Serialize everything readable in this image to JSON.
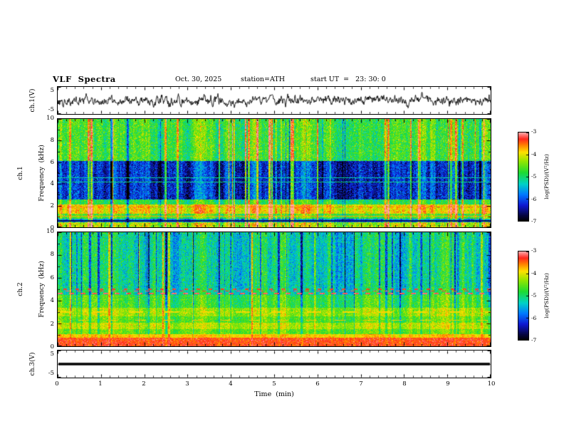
{
  "header": {
    "title": "VLF  Spectra",
    "date": "Oct. 30, 2025",
    "station": "station=ATH",
    "start_ut": "start UT  =   23: 30: 0"
  },
  "time_axis": {
    "label": "Time  (min)",
    "min": 0,
    "max": 10,
    "ticks": [
      0,
      1,
      2,
      3,
      4,
      5,
      6,
      7,
      8,
      9,
      10
    ],
    "minor_per_major": 5
  },
  "colorbar": {
    "label": "log(PSD)/(V²/Hz)",
    "min": -7,
    "max": -3,
    "ticks": [
      -3,
      -4,
      -5,
      -6,
      -7
    ]
  },
  "colormap_stops": [
    [
      0.0,
      0,
      0,
      0
    ],
    [
      0.06,
      5,
      5,
      60
    ],
    [
      0.18,
      15,
      25,
      210
    ],
    [
      0.3,
      0,
      120,
      255
    ],
    [
      0.42,
      0,
      210,
      200
    ],
    [
      0.55,
      30,
      220,
      50
    ],
    [
      0.68,
      150,
      230,
      0
    ],
    [
      0.78,
      255,
      225,
      0
    ],
    [
      0.86,
      255,
      130,
      0
    ],
    [
      0.93,
      255,
      40,
      30
    ],
    [
      1.0,
      255,
      165,
      165
    ]
  ],
  "chart_data": [
    {
      "type": "line",
      "name": "ch1_waveform",
      "ylabel": "ch.1(V)",
      "ylim": [
        -5,
        5
      ],
      "yticks": [
        5,
        -5
      ],
      "xlim": [
        0,
        10
      ],
      "seed": 20251030,
      "description": "dense broadband noise time series, ~±3.5 V peak about 0 V"
    },
    {
      "type": "heatmap",
      "name": "ch1_spectrogram",
      "channel_label": "ch.1",
      "ylabel": "Frequency  (kHz)",
      "ylim": [
        0,
        10
      ],
      "yticks": [
        0,
        2,
        4,
        6,
        8,
        10
      ],
      "xlim": [
        0,
        10
      ],
      "zlim": [
        -7,
        -3
      ],
      "seed": 1193046,
      "spike_up_prob": 0.06,
      "spike_dn_prob": 0.02,
      "spike_up_amp": 1.15,
      "spike_dn_amp": 0.8,
      "bands": [
        {
          "f0": 0.0,
          "f1": 0.45,
          "base": -4.25,
          "noise": 0.65
        },
        {
          "f0": 0.45,
          "f1": 0.8,
          "base": -5.7,
          "noise": 0.55
        },
        {
          "f0": 0.8,
          "f1": 1.25,
          "base": -4.7,
          "noise": 0.55
        },
        {
          "f0": 1.25,
          "f1": 2.1,
          "base": -3.95,
          "noise": 0.5
        },
        {
          "f0": 2.1,
          "f1": 2.55,
          "base": -4.9,
          "noise": 0.5
        },
        {
          "f0": 2.55,
          "f1": 6.1,
          "base": -6.25,
          "noise": 0.6,
          "col_gain": 1.25
        },
        {
          "f0": 6.1,
          "f1": 10.0,
          "base": -4.75,
          "noise": 0.6
        }
      ],
      "hlines": [
        {
          "f": 0.6,
          "v": -6.6,
          "hw": 0.05
        },
        {
          "f": 1.0,
          "v": -3.7,
          "hw": 0.04
        },
        {
          "f": 1.9,
          "v": -3.5,
          "hw": 0.04,
          "dash": [
            9,
            5
          ]
        },
        {
          "f": 4.2,
          "v": -5.1,
          "hw": 0.04
        },
        {
          "f": 4.55,
          "v": -5.2,
          "hw": 0.04
        }
      ],
      "description": "green noisy background with strong vertical striations, deep blue quiet band 2.6–6.1 kHz, bright yellow band 1.3–2.1 kHz"
    },
    {
      "type": "heatmap",
      "name": "ch2_spectrogram",
      "channel_label": "ch.2",
      "ylabel": "Frequency  (kHz)",
      "ylim": [
        0,
        10
      ],
      "yticks": [
        0,
        2,
        4,
        6,
        8,
        10
      ],
      "xlim": [
        0,
        10
      ],
      "zlim": [
        -7,
        -3
      ],
      "seed": 987231,
      "spike_up_prob": 0.03,
      "spike_dn_prob": 0.06,
      "spike_up_amp": 0.85,
      "spike_dn_amp": 1.0,
      "bands": [
        {
          "f0": 0.0,
          "f1": 0.75,
          "base": -3.35,
          "noise": 0.3,
          "col_gain": 0.15
        },
        {
          "f0": 0.75,
          "f1": 1.05,
          "base": -3.8,
          "noise": 0.3,
          "col_gain": 0.3
        },
        {
          "f0": 1.05,
          "f1": 1.5,
          "base": -4.5,
          "noise": 0.4,
          "col_gain": 0.5
        },
        {
          "f0": 1.5,
          "f1": 2.05,
          "base": -4.15,
          "noise": 0.4,
          "col_gain": 0.5
        },
        {
          "f0": 2.05,
          "f1": 2.6,
          "base": -4.55,
          "noise": 0.45,
          "col_gain": 0.6
        },
        {
          "f0": 2.6,
          "f1": 3.4,
          "base": -4.25,
          "noise": 0.45,
          "col_gain": 0.6
        },
        {
          "f0": 3.4,
          "f1": 4.5,
          "base": -4.7,
          "noise": 0.5,
          "col_gain": 0.8
        },
        {
          "f0": 4.5,
          "f1": 5.1,
          "base": -5.1,
          "noise": 0.5
        },
        {
          "f0": 5.1,
          "f1": 10.0,
          "base": -5.15,
          "noise": 0.6
        }
      ],
      "hlines": [
        {
          "f": 4.62,
          "v": -3.15,
          "hw": 0.05,
          "dash": [
            7,
            9
          ]
        },
        {
          "f": 4.85,
          "v": -3.2,
          "hw": 0.05,
          "dash": [
            6,
            10
          ],
          "phase": 5
        },
        {
          "f": 5.0,
          "v": -3.3,
          "hw": 0.04,
          "dash": [
            5,
            12
          ],
          "phase": 9
        },
        {
          "f": 3.0,
          "v": -3.9,
          "hw": 0.04,
          "dash": [
            20,
            30
          ]
        },
        {
          "f": 2.3,
          "v": -3.8,
          "hw": 0.04,
          "dash": [
            15,
            25
          ],
          "phase": 11
        }
      ],
      "description": "intense red band below 0.75 kHz, layered yellow-green bands 1–4.5 kHz with dark-red dashed lines near 4.6–5 kHz, cyan-green upper region with blue vertical streaks"
    },
    {
      "type": "line",
      "name": "ch3_waveform",
      "ylabel": "ch.3(V)",
      "ylim": [
        -5,
        5
      ],
      "yticks": [
        5,
        -5
      ],
      "xlim": [
        0,
        10
      ],
      "flat_value": 0,
      "description": "flat thick trace at 0 V (no signal)"
    }
  ]
}
